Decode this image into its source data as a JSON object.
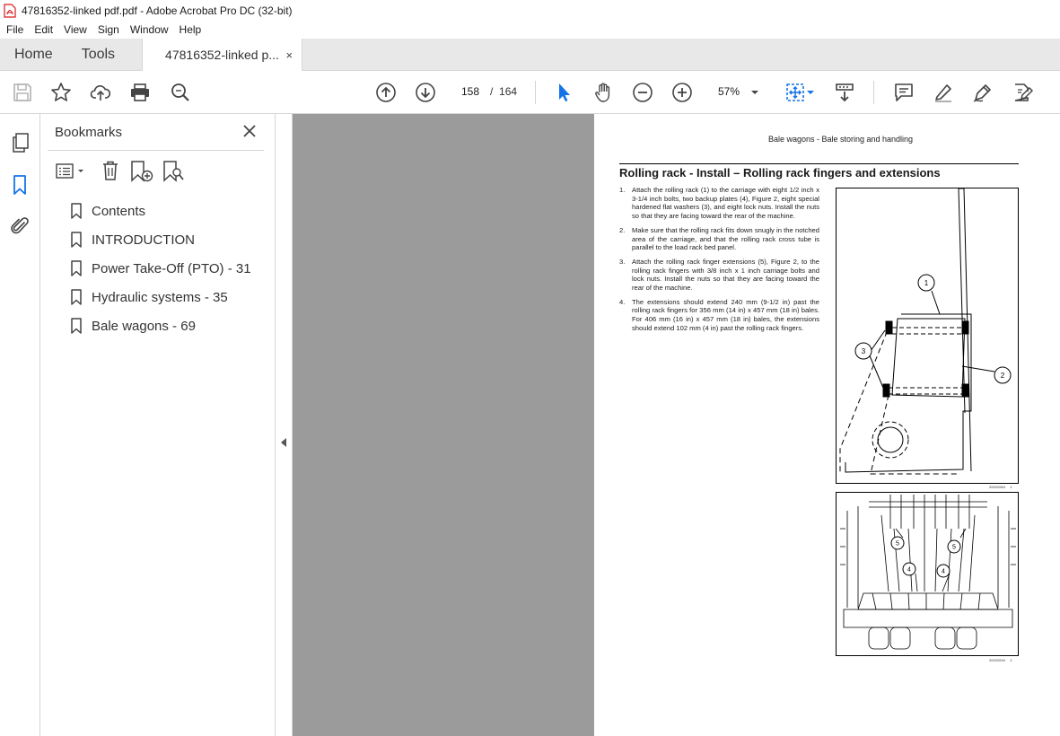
{
  "window": {
    "title": "47816352-linked pdf.pdf - Adobe Acrobat Pro DC (32-bit)"
  },
  "menu": [
    "File",
    "Edit",
    "View",
    "Sign",
    "Window",
    "Help"
  ],
  "tabs": {
    "home": "Home",
    "tools": "Tools",
    "document": "47816352-linked p...",
    "close": "×"
  },
  "toolbar": {
    "current_page": "158",
    "page_sep": "/",
    "total_pages": "164",
    "zoom": "57%"
  },
  "bookmarks": {
    "title": "Bookmarks",
    "items": [
      {
        "label": "Contents"
      },
      {
        "label": "INTRODUCTION"
      },
      {
        "label": "Power Take-Off (PTO) - 31"
      },
      {
        "label": "Hydraulic systems - 35"
      },
      {
        "label": "Bale wagons - 69"
      }
    ]
  },
  "document": {
    "header": "Bale wagons - Bale storing and handling",
    "heading": "Rolling rack - Install – Rolling rack fingers and extensions",
    "steps": [
      {
        "num": "1.",
        "text": "Attach the rolling rack (1) to the carriage with eight 1/2 inch x 3-1/4 inch bolts, two backup plates (4), Figure 2, eight special hardened flat washers (3), and eight lock nuts. Install the nuts so that they are facing toward the rear of the machine."
      },
      {
        "num": "2.",
        "text": "Make sure that the rolling rack fits down snugly in the notched area of the carriage, and that the rolling rack cross tube is parallel to the load rack bed panel."
      },
      {
        "num": "3.",
        "text": "Attach the rolling rack finger extensions (5), Figure 2, to the rolling rack fingers with 3/8 inch x 1 inch carriage bolts and lock nuts.  Install the nuts so that they are facing toward the rear of the machine."
      },
      {
        "num": "4.",
        "text": "The extensions should extend 240 mm (9-1/2 in) past the rolling rack fingers for 356 mm (14 in) x 457 mm (18 in) bales.  For 406 mm (16 in) x 457 mm (18 in) bales, the extensions should extend 102 mm (4 in) past the rolling rack fingers."
      }
    ],
    "figure1": {
      "code": "20022084",
      "num": "1",
      "callouts": [
        "1",
        "2",
        "3"
      ]
    },
    "figure2": {
      "code": "20022094",
      "num": "2",
      "callouts": [
        "5",
        "5",
        "4",
        "4"
      ]
    }
  },
  "colors": {
    "accent": "#1473e6",
    "acrobat_red": "#d7191c",
    "viewport_bg": "#9b9b9b"
  }
}
